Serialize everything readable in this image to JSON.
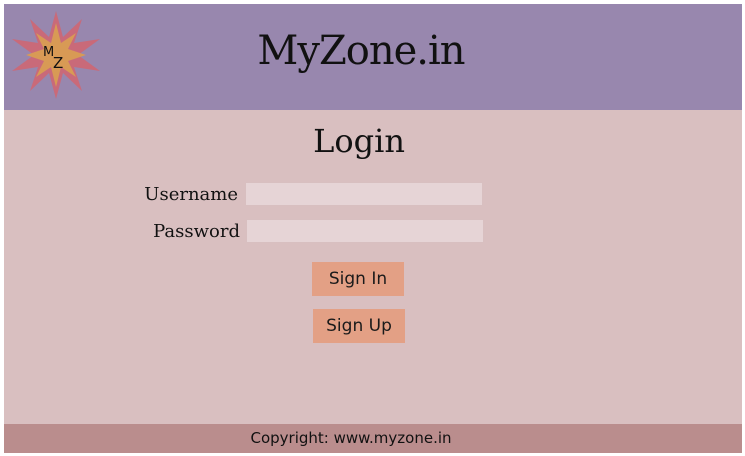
{
  "header": {
    "logo_letters": [
      "M",
      "Z"
    ],
    "title": "MyZone.in",
    "background": "#9887ae"
  },
  "login": {
    "title": "Login",
    "username_label": "Username",
    "password_label": "Password",
    "username_value": "",
    "password_value": "",
    "signin_label": "Sign In",
    "signup_label": "Sign Up"
  },
  "footer": {
    "text": "Copyright: www.myzone.in",
    "background": "#ba8d8d"
  },
  "colors": {
    "page": "#d9bfc0",
    "button": "#e3a085",
    "input": "#e6d4d6",
    "logo_outer": "#c96a79",
    "logo_inner": "#d89a55"
  }
}
